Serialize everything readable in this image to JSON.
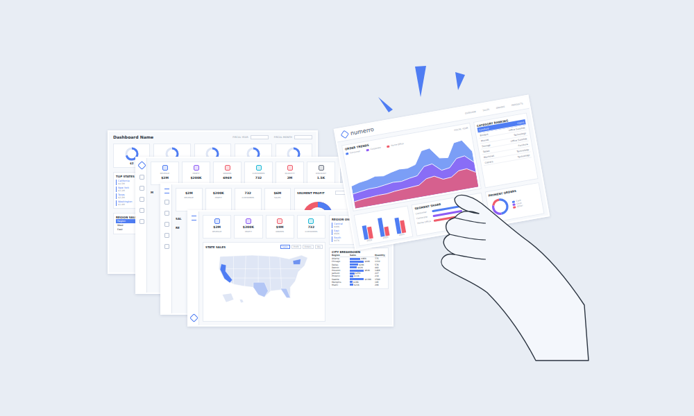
{
  "sparks": 3,
  "card1": {
    "title": "Dashboard Name",
    "filters": [
      "FISCAL YEAR",
      "FISCAL MONTH"
    ],
    "donuts": [
      {
        "level": 0.7,
        "value": "$2"
      },
      {
        "level": 0.5,
        "value": ""
      },
      {
        "level": 0.55,
        "value": ""
      },
      {
        "level": 0.6,
        "value": ""
      },
      {
        "level": 0.45,
        "value": ""
      }
    ],
    "list_title": "TOP STATES B",
    "list": [
      {
        "name": "California",
        "value": "$4.5M"
      },
      {
        "name": "New York",
        "value": "$3.1M"
      },
      {
        "name": "Texas",
        "value": "$2.2M"
      },
      {
        "name": "Washington",
        "value": "$1.4M"
      }
    ],
    "table_title": "REGION SALES",
    "table_rows": [
      {
        "label": "Region",
        "selected": true
      },
      {
        "label": "West",
        "selected": false
      },
      {
        "label": "East",
        "selected": false
      }
    ]
  },
  "card2": {
    "kpis": [
      {
        "label": "REVENUE",
        "value": "$2M",
        "color": "#4f7df3"
      },
      {
        "label": "PROFIT",
        "value": "$200K",
        "color": "#8e5cf5"
      },
      {
        "label": "ORDERS",
        "value": "6969",
        "color": "#f05c6b"
      },
      {
        "label": "CUSTOMERS",
        "value": "732",
        "color": "#1cb8d6"
      },
      {
        "label": "QUANTITY",
        "value": "2M",
        "color": "#f05c6b"
      },
      {
        "label": "DISCOUNT",
        "value": "1.5K",
        "color": "#6b7280"
      }
    ],
    "section": "M"
  },
  "card3": {
    "kpis": [
      {
        "label": "REVENUE",
        "value": "$2M"
      },
      {
        "label": "PROFIT",
        "value": "$200K"
      },
      {
        "label": "CUSTOMERS",
        "value": "732"
      },
      {
        "label": "SALES",
        "value": "$6M"
      }
    ],
    "panel_title": "SEGMENT PROFIT",
    "section": "SAL",
    "section2": "RE"
  },
  "card4": {
    "kpis": [
      {
        "label": "REVENUE",
        "value": "$2M",
        "color": "#4f7df3"
      },
      {
        "label": "PROFIT",
        "value": "$200K",
        "color": "#8e5cf5"
      },
      {
        "label": "ORDERS",
        "value": "$9M",
        "color": "#f05c6b"
      },
      {
        "label": "CUSTOMERS",
        "value": "732",
        "color": "#1cb8d6"
      }
    ],
    "map_title": "STATE SALES",
    "map_tabs": [
      {
        "label": "Sales",
        "selected": true
      },
      {
        "label": "Profit",
        "selected": false
      },
      {
        "label": "Orders",
        "selected": false
      },
      {
        "label": "Qty",
        "selected": false
      }
    ],
    "states": [
      {
        "name": "California",
        "color": "#4f7df3"
      },
      {
        "name": "New York",
        "color": "#6f93f0"
      },
      {
        "name": "Texas",
        "color": "#b3c6f5"
      },
      {
        "name": "Florida",
        "color": "#b3c6f5"
      }
    ],
    "region_title": "REGION OVERVIEW",
    "regions": [
      {
        "name": "Central",
        "a": "$501K",
        "b": "$40K"
      },
      {
        "name": "East",
        "a": "$679K",
        "b": "$92K"
      },
      {
        "name": "South",
        "a": "$392K",
        "b": "$47K"
      }
    ],
    "city_title": "CITY BREAKDOWN",
    "city_columns": [
      "Region",
      "Sales",
      "Quantity"
    ],
    "cities": [
      {
        "name": "Atlanta",
        "sales": "$96K",
        "qty": "775",
        "level": 0.45
      },
      {
        "name": "Chicago",
        "sales": "$48K",
        "qty": "1132",
        "level": 0.7
      },
      {
        "name": "Dallas",
        "sales": "$20K",
        "qty": "576",
        "level": 0.35
      },
      {
        "name": "Detroit",
        "sales": "$42K",
        "qty": "482",
        "level": 0.3
      },
      {
        "name": "Houston",
        "sales": "$64K",
        "qty": "1466",
        "level": 0.85
      },
      {
        "name": "Jackson",
        "sales": "$25K",
        "qty": "227",
        "level": 0.2
      },
      {
        "name": "Phoenix",
        "sales": "$11K",
        "qty": "218",
        "level": 0.15
      },
      {
        "name": "Seattle",
        "sales": "$119K",
        "qty": "1590",
        "level": 0.9
      },
      {
        "name": "Memphis",
        "sales": "$16K",
        "qty": "195",
        "level": 0.12
      },
      {
        "name": "Miami",
        "sales": "$21K",
        "qty": "206",
        "level": 0.15
      }
    ]
  },
  "main": {
    "logo": "numerro",
    "nav": [
      "OVERVIEW",
      "SALES",
      "ORDERS",
      "PRODUCTS"
    ],
    "filter": "FISCAL YEAR",
    "trend_title": "ORDER TRENDS",
    "trend_legend": [
      {
        "label": "Consumer",
        "color": "#4f7df3"
      },
      {
        "label": "Corporate",
        "color": "#8e5cf5"
      },
      {
        "label": "Home Office",
        "color": "#f05c6b"
      }
    ],
    "trend_series": [
      [
        40,
        44,
        46,
        50,
        48,
        52,
        55,
        54,
        58,
        80,
        82,
        62,
        60,
        84,
        86,
        64
      ],
      [
        26,
        28,
        30,
        30,
        32,
        34,
        33,
        36,
        38,
        52,
        54,
        40,
        42,
        56,
        58,
        44
      ],
      [
        12,
        14,
        15,
        16,
        16,
        18,
        19,
        20,
        21,
        30,
        32,
        24,
        25,
        34,
        35,
        26
      ]
    ],
    "ranking_title": "CATEGORY RANKING",
    "ranking": [
      {
        "name": "Furniture",
        "value": "Chairs",
        "selected": true
      },
      {
        "name": "Binders",
        "value": "Office Supplies",
        "selected": false
      },
      {
        "name": "Phones",
        "value": "Technology",
        "selected": false
      },
      {
        "name": "Storage",
        "value": "Office Supplies",
        "selected": false
      },
      {
        "name": "Tables",
        "value": "Furniture",
        "selected": false
      },
      {
        "name": "Machines",
        "value": "Technology",
        "selected": false
      },
      {
        "name": "Copiers",
        "value": "Technology",
        "selected": false
      }
    ],
    "bars": [
      {
        "label": "2019",
        "values": [
          0.6,
          0.5
        ]
      },
      {
        "label": "2020",
        "values": [
          0.8,
          0.4
        ]
      },
      {
        "label": "2021",
        "values": [
          0.7,
          0.55
        ]
      }
    ],
    "share_title": "SEGMENT SHARE",
    "share": [
      {
        "label": "Consumer",
        "level": 0.8,
        "color": "#4f7df3"
      },
      {
        "label": "Corporate",
        "level": 0.6,
        "color": "#8e5cf5"
      },
      {
        "label": "Home Office",
        "level": 0.45,
        "color": "#f05c6b"
      }
    ],
    "payment_title": "PAYMENT ORDERS",
    "payment": [
      {
        "label": "Card",
        "level": 0.5,
        "color": "#4f7df3"
      },
      {
        "label": "Cash",
        "level": 0.3,
        "color": "#8e5cf5"
      },
      {
        "label": "Other",
        "level": 0.2,
        "color": "#f05c6b"
      }
    ]
  }
}
